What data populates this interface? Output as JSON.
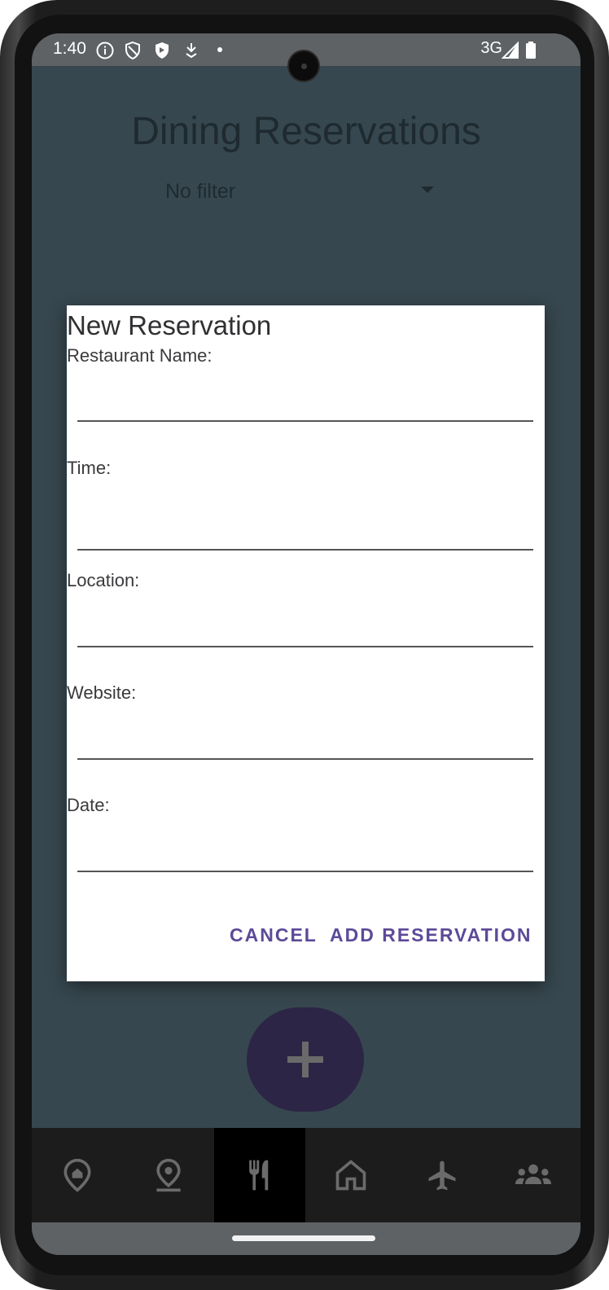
{
  "status_bar": {
    "time": "1:40",
    "network": "3G",
    "icons": [
      "info-icon",
      "shield-outline-icon",
      "shield-filled-icon",
      "download-icon",
      "dot-icon",
      "signal-icon",
      "battery-icon"
    ]
  },
  "app": {
    "title": "Dining Reservations",
    "filter_value": "No filter"
  },
  "dialog": {
    "title": "New Reservation",
    "fields": [
      {
        "label": "Restaurant Name:",
        "value": ""
      },
      {
        "label": "Time:",
        "value": ""
      },
      {
        "label": "Location:",
        "value": ""
      },
      {
        "label": "Website:",
        "value": ""
      },
      {
        "label": "Date:",
        "value": ""
      }
    ],
    "cancel_label": "CANCEL",
    "confirm_label": "ADD RESERVATION"
  },
  "bottom_nav": {
    "items": [
      {
        "icon": "home-pin-icon",
        "active": false
      },
      {
        "icon": "location-pin-icon",
        "active": false
      },
      {
        "icon": "restaurant-icon",
        "active": true
      },
      {
        "icon": "house-icon",
        "active": false
      },
      {
        "icon": "airplane-icon",
        "active": false
      },
      {
        "icon": "group-icon",
        "active": false
      }
    ]
  },
  "colors": {
    "app_background": "#37474f",
    "accent": "#5c4a98",
    "fab": "#2c2545",
    "nav_background": "#1c1c1c"
  }
}
